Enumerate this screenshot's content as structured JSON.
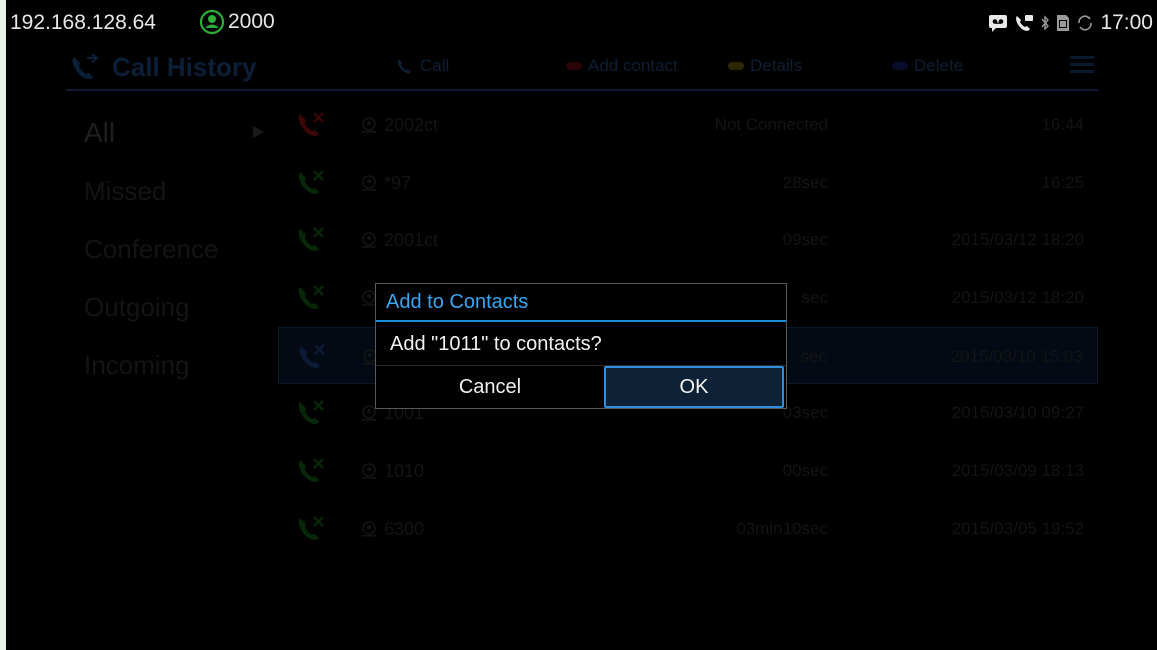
{
  "statusbar": {
    "ip": "192.168.128.64",
    "account": "2000",
    "time": "17:00",
    "icons": [
      "voicemail-icon",
      "missed-call-icon",
      "bluetooth-icon",
      "sim-icon",
      "sync-icon"
    ]
  },
  "header": {
    "title": "Call History",
    "call_label": "Call",
    "add_contact_label": "Add contact",
    "details_label": "Details",
    "delete_label": "Delete"
  },
  "sidebar": {
    "items": [
      {
        "label": "All"
      },
      {
        "label": "Missed"
      },
      {
        "label": "Conference"
      },
      {
        "label": "Outgoing"
      },
      {
        "label": "Incoming"
      }
    ]
  },
  "calls": [
    {
      "number": "2002ct",
      "duration": "Not Connected",
      "time": "16:44",
      "type": "missed"
    },
    {
      "number": "*97",
      "duration": "28sec",
      "time": "16:25",
      "type": "outgoing"
    },
    {
      "number": "2001ct",
      "duration": "09sec",
      "time": "2015/03/12 18:20",
      "type": "outgoing"
    },
    {
      "number": "",
      "duration": "sec",
      "time": "2015/03/12 18:20",
      "type": "incoming"
    },
    {
      "number": "",
      "duration": "sec",
      "time": "2015/03/10 15:03",
      "type": "conference"
    },
    {
      "number": "1001",
      "duration": "03sec",
      "time": "2015/03/10 09:27",
      "type": "incoming"
    },
    {
      "number": "1010",
      "duration": "00sec",
      "time": "2015/03/09 18:13",
      "type": "outgoing"
    },
    {
      "number": "6300",
      "duration": "03min10sec",
      "time": "2015/03/05 19:52",
      "type": "outgoing"
    }
  ],
  "dialog": {
    "title": "Add to Contacts",
    "message": "Add \"1011\" to contacts?",
    "cancel_label": "Cancel",
    "ok_label": "OK"
  },
  "colors": {
    "dialog_accent": "#3aa6f2",
    "account_badge": "#2fae3a"
  }
}
